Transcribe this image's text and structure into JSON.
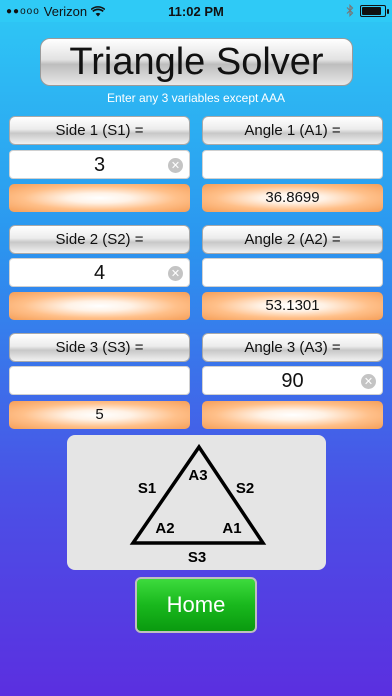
{
  "status": {
    "carrier": "Verizon",
    "signal_dots": "●●ooo",
    "time": "11:02 PM",
    "battery_level": 0.85
  },
  "title": "Triangle Solver",
  "subtitle": "Enter any 3 variables except AAA",
  "sides": [
    {
      "label": "Side 1 (S1) =",
      "value": "3",
      "result": ""
    },
    {
      "label": "Side 2 (S2) =",
      "value": "4",
      "result": ""
    },
    {
      "label": "Side 3 (S3) =",
      "value": "",
      "result": "5"
    }
  ],
  "angles": [
    {
      "label": "Angle 1 (A1) =",
      "value": "",
      "result": "36.8699"
    },
    {
      "label": "Angle 2 (A2) =",
      "value": "",
      "result": "53.1301"
    },
    {
      "label": "Angle 3 (A3) =",
      "value": "90",
      "result": ""
    }
  ],
  "diagram_labels": {
    "s1": "S1",
    "s2": "S2",
    "s3": "S3",
    "a1": "A1",
    "a2": "A2",
    "a3": "A3"
  },
  "home_label": "Home",
  "clear_glyph": "✕"
}
